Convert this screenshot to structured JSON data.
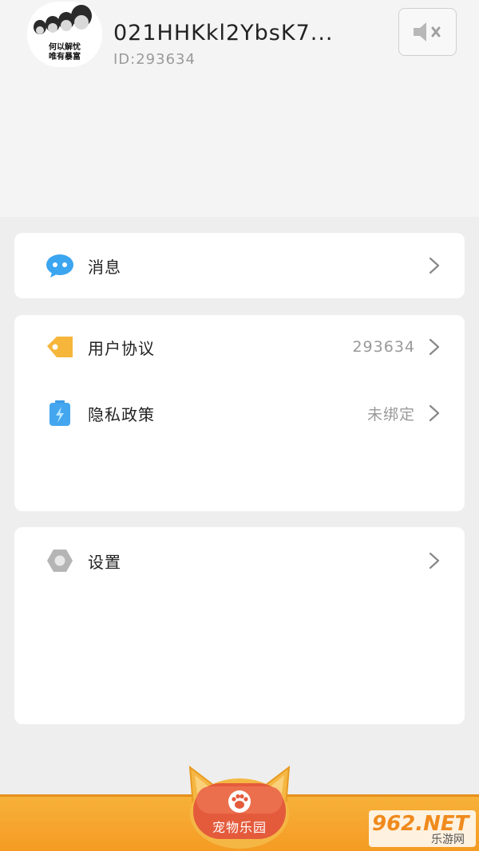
{
  "profile": {
    "avatar_caption_line1": "何以解忧",
    "avatar_caption_line2": "唯有暴富",
    "username": "021HHKkl2YbsK7...",
    "user_id": "ID:293634"
  },
  "header": {
    "mute_icon": "speaker-muted-icon"
  },
  "menu": {
    "message": {
      "label": "消息",
      "icon": "message-bubble-icon"
    },
    "agreement": {
      "label": "用户协议",
      "value": "293634",
      "icon": "tag-icon"
    },
    "privacy": {
      "label": "隐私政策",
      "value": "未绑定",
      "icon": "battery-icon"
    },
    "settings": {
      "label": "设置",
      "icon": "hexagon-gear-icon"
    }
  },
  "bottom_nav": {
    "pet_park_label": "宠物乐园",
    "pet_park_icon": "paw-icon"
  },
  "watermark": {
    "main": "962.NET",
    "sub": "乐游网"
  },
  "colors": {
    "accent_orange": "#f5a52d",
    "tab_red": "#e25a3a",
    "text_primary": "#222222",
    "text_secondary": "#999999"
  }
}
